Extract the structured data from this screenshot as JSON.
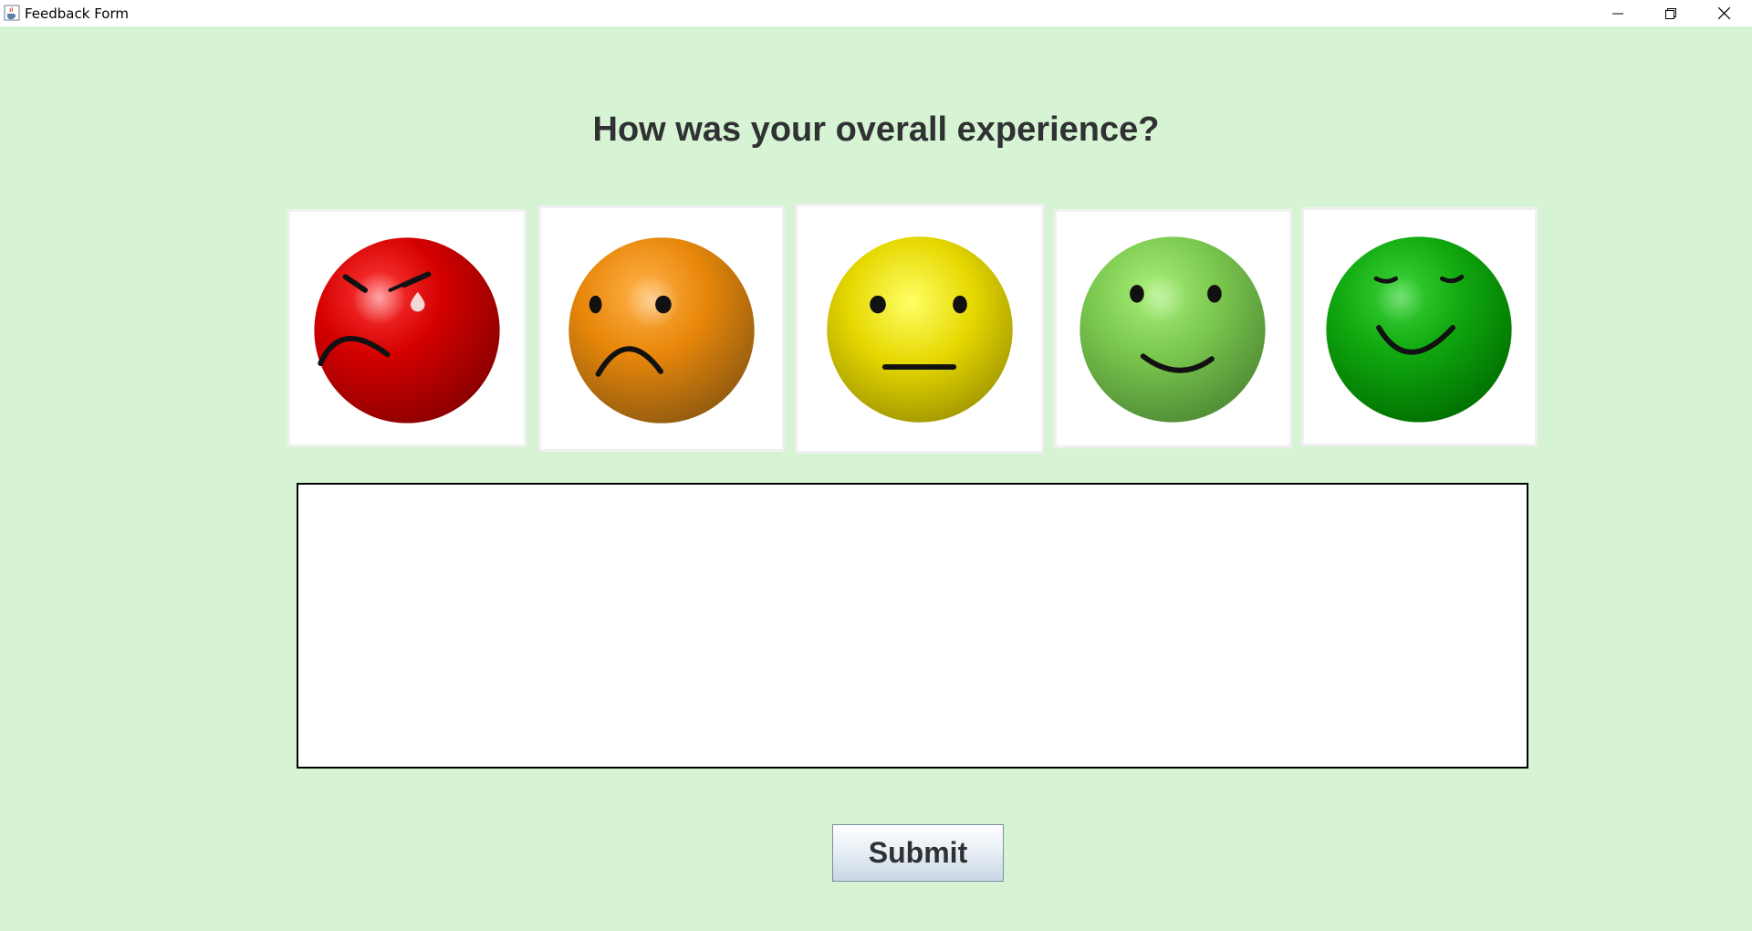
{
  "window": {
    "title": "Feedback Form",
    "icons": {
      "app": "java-cup-icon",
      "minimize": "minimize-icon",
      "maximize": "restore-icon",
      "close": "close-icon"
    }
  },
  "form": {
    "question": "How was your overall experience?",
    "ratings": [
      {
        "name": "very-dissatisfied",
        "color": "#d40000",
        "icon": "angry-crying-face-icon"
      },
      {
        "name": "dissatisfied",
        "color": "#e8870a",
        "icon": "sad-face-icon"
      },
      {
        "name": "neutral",
        "color": "#e6d800",
        "icon": "neutral-face-icon"
      },
      {
        "name": "satisfied",
        "color": "#7cc94f",
        "icon": "smiling-face-icon"
      },
      {
        "name": "very-satisfied",
        "color": "#10a80f",
        "icon": "grinning-face-icon"
      }
    ],
    "comment_value": "",
    "submit_label": "Submit"
  },
  "colors": {
    "background": "#d6f4d3",
    "titlebar": "#ffffff"
  }
}
